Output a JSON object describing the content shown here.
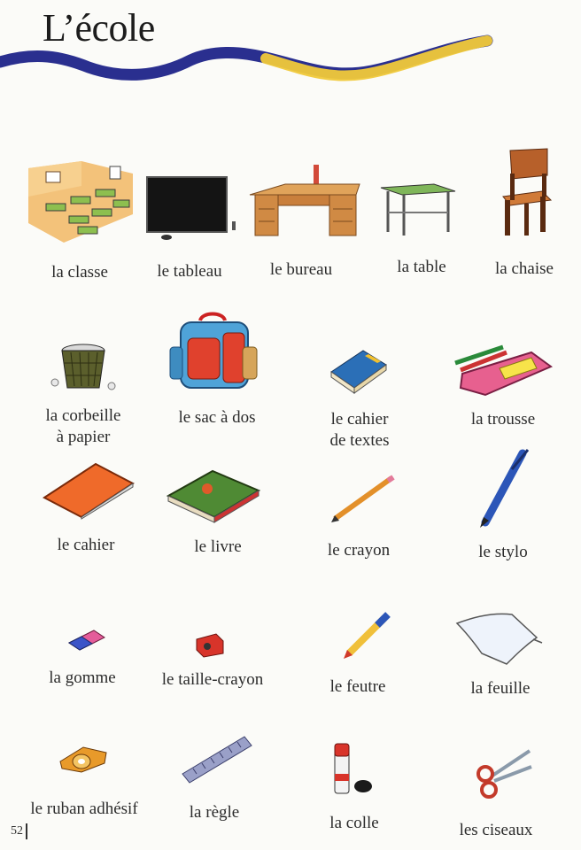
{
  "page": {
    "title": "L’école",
    "page_number": "52",
    "wave_colors": {
      "blue": "#2a2f8f",
      "yellow": "#f0c93a"
    }
  },
  "vocabulary": [
    {
      "label": "la classe",
      "icon": "classroom-icon"
    },
    {
      "label": "le tableau",
      "icon": "blackboard-icon"
    },
    {
      "label": "le bureau",
      "icon": "desk-icon"
    },
    {
      "label": "la table",
      "icon": "table-icon"
    },
    {
      "label": "la chaise",
      "icon": "chair-icon"
    },
    {
      "label": "la corbeille\nà papier",
      "icon": "wastebasket-icon"
    },
    {
      "label": "le sac à dos",
      "icon": "backpack-icon"
    },
    {
      "label": "le cahier\nde textes",
      "icon": "homework-diary-icon"
    },
    {
      "label": "la trousse",
      "icon": "pencil-case-icon"
    },
    {
      "label": "le cahier",
      "icon": "notebook-icon"
    },
    {
      "label": "le livre",
      "icon": "book-icon"
    },
    {
      "label": "le crayon",
      "icon": "pencil-icon"
    },
    {
      "label": "le stylo",
      "icon": "pen-icon"
    },
    {
      "label": "la gomme",
      "icon": "eraser-icon"
    },
    {
      "label": "le taille-crayon",
      "icon": "sharpener-icon"
    },
    {
      "label": "le feutre",
      "icon": "marker-icon"
    },
    {
      "label": "la feuille",
      "icon": "paper-sheet-icon"
    },
    {
      "label": "le ruban adhésif",
      "icon": "tape-icon"
    },
    {
      "label": "la règle",
      "icon": "ruler-icon"
    },
    {
      "label": "la colle",
      "icon": "glue-stick-icon"
    },
    {
      "label": "les ciseaux",
      "icon": "scissors-icon"
    }
  ]
}
